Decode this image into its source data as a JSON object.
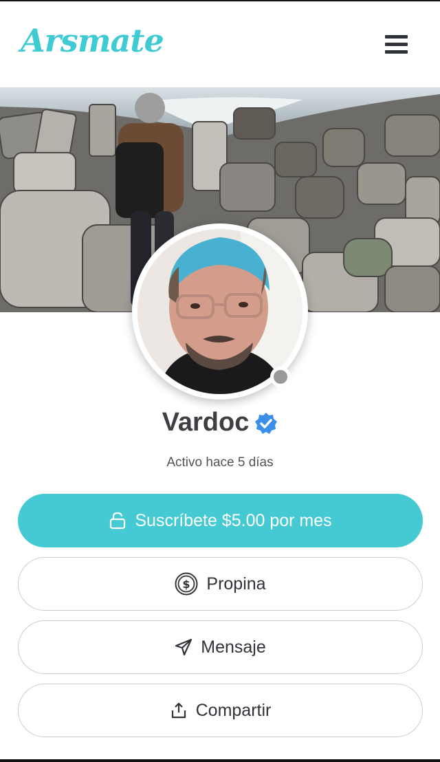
{
  "header": {
    "logo_text": "Arsmate",
    "menu_icon": "hamburger-menu-icon"
  },
  "profile": {
    "name": "Vardoc",
    "verified_icon": "verified-badge-icon",
    "activity": "Activo hace 5 días",
    "status": "offline"
  },
  "actions": {
    "subscribe_label": "Suscríbete $5.00 por mes",
    "tip_label": "Propina",
    "message_label": "Mensaje",
    "share_label": "Compartir"
  },
  "colors": {
    "accent": "#45c9d3",
    "verified": "#3b8fe8",
    "status_offline": "#9a9a9a"
  }
}
